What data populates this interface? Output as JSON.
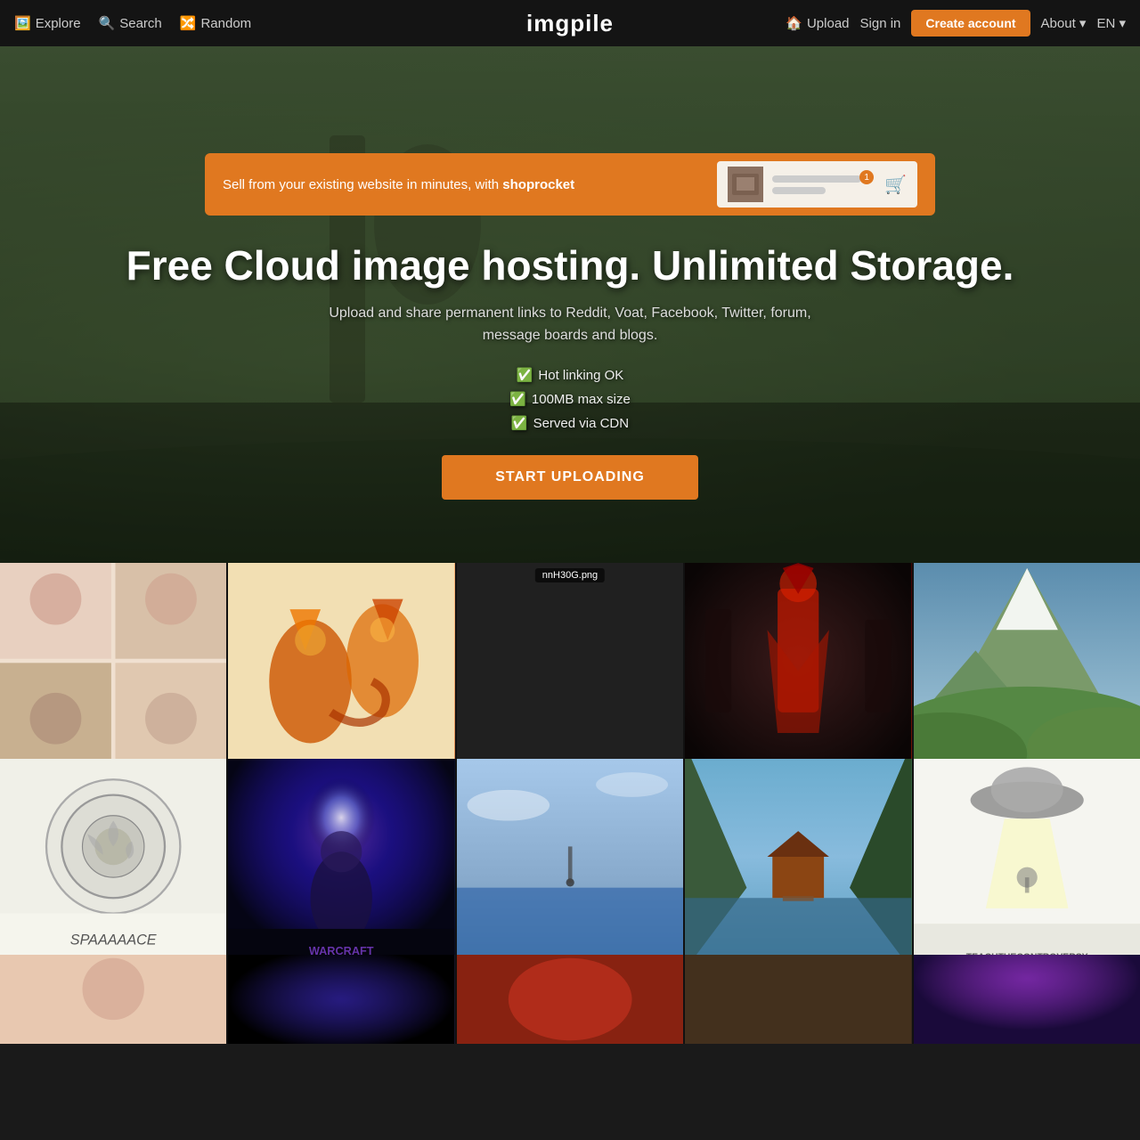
{
  "navbar": {
    "explore_label": "Explore",
    "search_label": "Search",
    "random_label": "Random",
    "logo": "imgpile",
    "upload_label": "Upload",
    "signin_label": "Sign in",
    "create_account_label": "Create account",
    "about_label": "About ▾",
    "lang_label": "EN ▾"
  },
  "ad": {
    "text": "Sell from your existing website in minutes, with ",
    "brand": "shoprocket",
    "badge": "1"
  },
  "hero": {
    "title": "Free Cloud image hosting. Unlimited Storage.",
    "subtitle": "Upload and share permanent links to Reddit, Voat, Facebook, Twitter, forum,\nmessage boards and blogs.",
    "feature1": "✅ Hot linking OK",
    "feature2": "✅ 100MB max size",
    "feature3": "✅ Served via CDN",
    "cta_label": "START UPLOADING"
  },
  "grid": {
    "rows": [
      [
        {
          "id": "g1",
          "filename": "",
          "style": "baby"
        },
        {
          "id": "g2",
          "filename": "",
          "style": "foxes"
        },
        {
          "id": "g3",
          "filename": "nnH30G.png",
          "style": "dark"
        },
        {
          "id": "g4",
          "filename": "",
          "style": "assassin"
        },
        {
          "id": "g5",
          "filename": "",
          "style": "mountain"
        }
      ],
      [
        {
          "id": "g6",
          "filename": "",
          "style": "space"
        },
        {
          "id": "g7",
          "filename": "",
          "style": "wow"
        },
        {
          "id": "g8",
          "filename": "",
          "style": "ocean"
        },
        {
          "id": "g9",
          "filename": "",
          "style": "cabin"
        },
        {
          "id": "g10",
          "filename": "",
          "style": "teach"
        }
      ]
    ],
    "partial": [
      {
        "id": "p1",
        "style": "partial-baby"
      },
      {
        "id": "p2",
        "style": "partial-dark"
      },
      {
        "id": "p3",
        "style": "partial-red"
      },
      {
        "id": "p4",
        "style": "partial-brown"
      },
      {
        "id": "p5",
        "style": "partial-purple"
      }
    ]
  }
}
